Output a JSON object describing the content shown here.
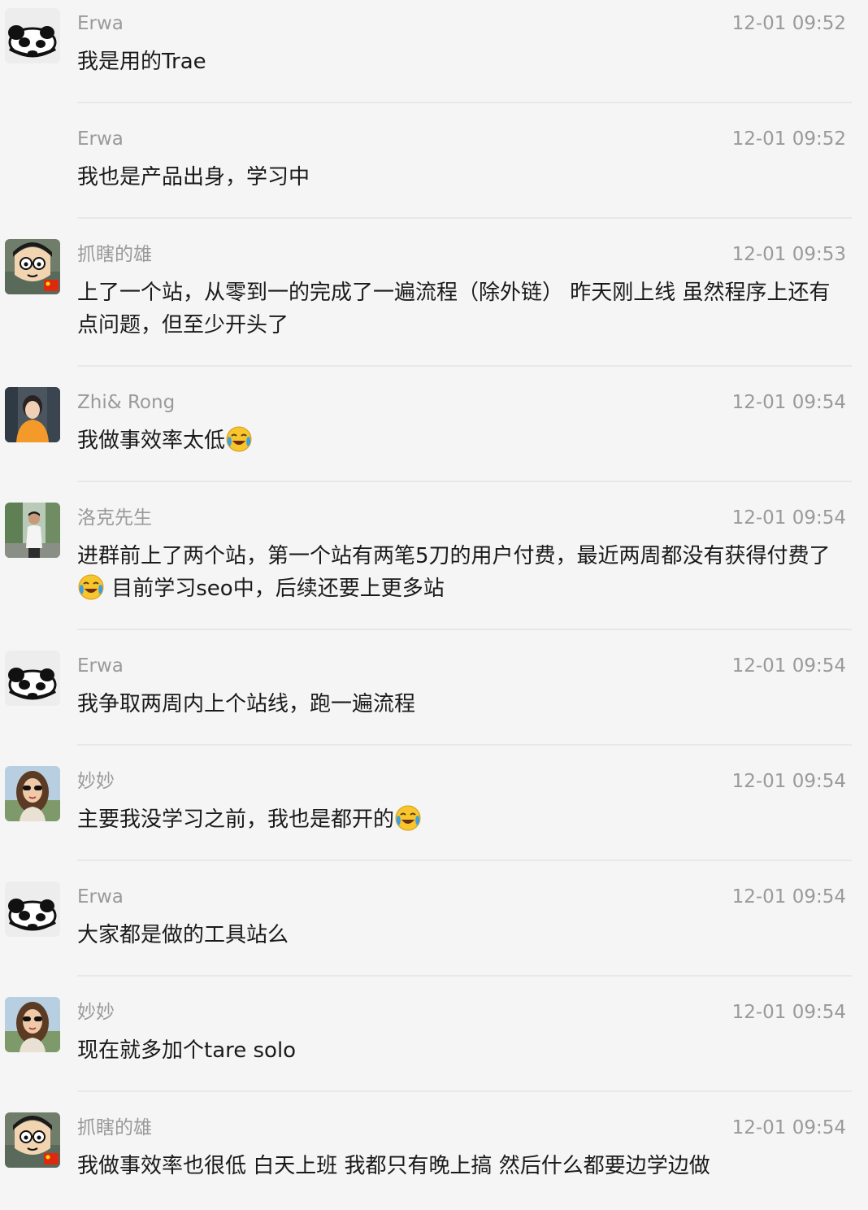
{
  "messages": [
    {
      "sender": "Erwa",
      "time": "12-01 09:52",
      "avatar": "panda-avatar",
      "segments": [
        {
          "t": "我是用的Trae"
        }
      ]
    },
    {
      "sender": "Erwa",
      "time": "12-01 09:52",
      "avatar": "none",
      "segments": [
        {
          "t": "我也是产品出身，学习中"
        }
      ]
    },
    {
      "sender": "抓瞎的雄",
      "time": "12-01 09:53",
      "avatar": "cartoon-boy-avatar",
      "segments": [
        {
          "t": "上了一个站，从零到一的完成了一遍流程（除外链） 昨天刚上线 虽然程序上还有点问题，但至少开头了"
        }
      ]
    },
    {
      "sender": "Zhi& Rong",
      "time": "12-01 09:54",
      "avatar": "girl-orange-jacket-avatar",
      "segments": [
        {
          "t": "我做事效率太低"
        },
        {
          "emoji": "crying-laughing-emoji"
        }
      ]
    },
    {
      "sender": "洛克先生",
      "time": "12-01 09:54",
      "avatar": "man-outdoor-avatar",
      "segments": [
        {
          "t": "进群前上了两个站，第一个站有两笔5刀的用户付费，最近两周都没有获得付费了"
        },
        {
          "emoji": "crying-laughing-emoji"
        },
        {
          "t": " 目前学习seo中，后续还要上更多站"
        }
      ]
    },
    {
      "sender": "Erwa",
      "time": "12-01 09:54",
      "avatar": "panda-avatar",
      "segments": [
        {
          "t": "我争取两周内上个站线，跑一遍流程"
        }
      ]
    },
    {
      "sender": "妙妙",
      "time": "12-01 09:54",
      "avatar": "woman-sunglasses-avatar",
      "segments": [
        {
          "t": "主要我没学习之前，我也是都开的"
        },
        {
          "emoji": "crying-laughing-emoji"
        }
      ]
    },
    {
      "sender": "Erwa",
      "time": "12-01 09:54",
      "avatar": "panda-avatar",
      "segments": [
        {
          "t": "大家都是做的工具站么"
        }
      ]
    },
    {
      "sender": "妙妙",
      "time": "12-01 09:54",
      "avatar": "woman-sunglasses-avatar",
      "segments": [
        {
          "t": "现在就多加个tare solo"
        }
      ]
    },
    {
      "sender": "抓瞎的雄",
      "time": "12-01 09:54",
      "avatar": "cartoon-boy-avatar",
      "segments": [
        {
          "t": "我做事效率也很低  白天上班  我都只有晚上搞  然后什么都要边学边做"
        }
      ]
    }
  ],
  "colors": {
    "background": "#f5f5f5",
    "meta_text": "#9a9a9a",
    "body_text": "#1a1a1a",
    "divider": "#e8e8e8"
  }
}
